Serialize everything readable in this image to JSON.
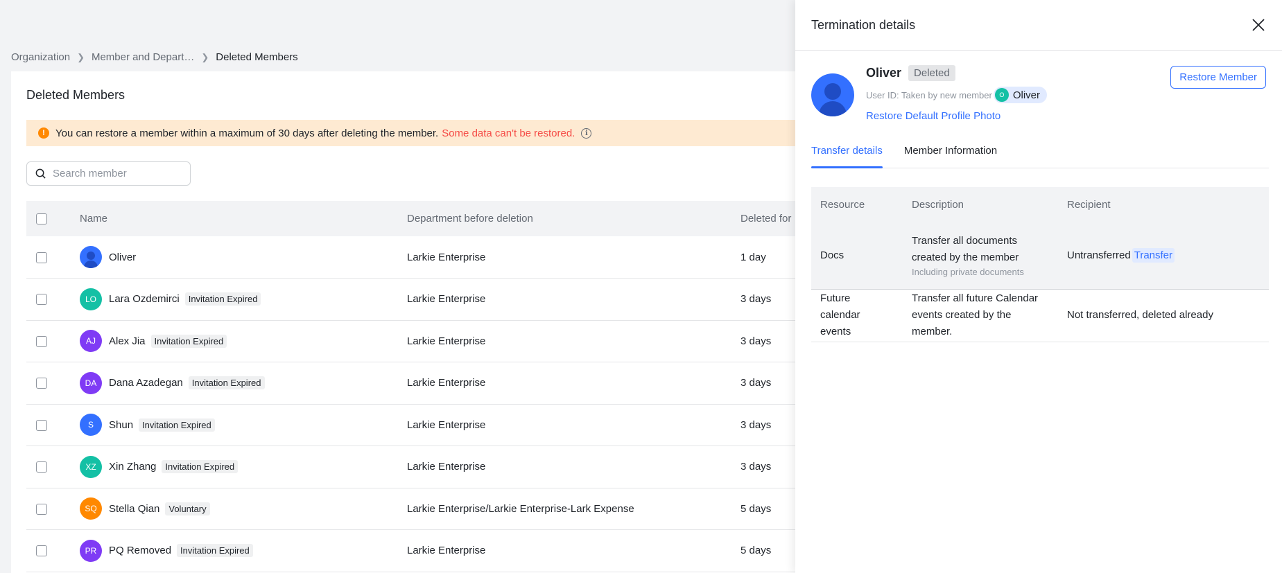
{
  "breadcrumb": {
    "items": [
      "Organization",
      "Member and Depart…",
      "Deleted Members"
    ]
  },
  "page": {
    "title": "Deleted Members",
    "notice": "You can restore a member within a maximum of 30 days after deleting the member.",
    "notice_warning": "Some data can't be restored.",
    "search_placeholder": "Search member"
  },
  "table": {
    "headers": {
      "name": "Name",
      "dept": "Department before deletion",
      "deleted": "Deleted for"
    },
    "rows": [
      {
        "initials": "",
        "name": "Oliver",
        "tag": "",
        "dept": "Larkie Enterprise",
        "deleted": "1 day",
        "color": "#3370ff"
      },
      {
        "initials": "LO",
        "name": "Lara Ozdemirci",
        "tag": "Invitation Expired",
        "dept": "Larkie Enterprise",
        "deleted": "3 days",
        "color": "#14c0a5"
      },
      {
        "initials": "AJ",
        "name": "Alex Jia",
        "tag": "Invitation Expired",
        "dept": "Larkie Enterprise",
        "deleted": "3 days",
        "color": "#7f3bf5"
      },
      {
        "initials": "DA",
        "name": "Dana Azadegan",
        "tag": "Invitation Expired",
        "dept": "Larkie Enterprise",
        "deleted": "3 days",
        "color": "#7f3bf5"
      },
      {
        "initials": "S",
        "name": "Shun",
        "tag": "Invitation Expired",
        "dept": "Larkie Enterprise",
        "deleted": "3 days",
        "color": "#3370ff"
      },
      {
        "initials": "XZ",
        "name": "Xin Zhang",
        "tag": "Invitation Expired",
        "dept": "Larkie Enterprise",
        "deleted": "3 days",
        "color": "#14c0a5"
      },
      {
        "initials": "SQ",
        "name": "Stella Qian",
        "tag": "Voluntary",
        "dept": "Larkie Enterprise/Larkie Enterprise-Lark Expense",
        "deleted": "5 days",
        "color": "#ff8800"
      },
      {
        "initials": "PR",
        "name": "PQ Removed",
        "tag": "Invitation Expired",
        "dept": "Larkie Enterprise",
        "deleted": "5 days",
        "color": "#7f3bf5"
      }
    ]
  },
  "drawer": {
    "title": "Termination details",
    "member_name": "Oliver",
    "status": "Deleted",
    "user_id_text": "User ID: Taken by new member",
    "new_member_initial": "O",
    "new_member_name": "Oliver",
    "restore_photo": "Restore Default Profile Photo",
    "restore_button": "Restore Member",
    "tabs": [
      "Transfer details",
      "Member Information"
    ],
    "resource_table": {
      "headers": {
        "resource": "Resource",
        "description": "Description",
        "recipient": "Recipient"
      },
      "rows": [
        {
          "resource": "Docs",
          "description": "Transfer all documents created by the member",
          "sub": "Including private documents",
          "recipient": "Untransferred",
          "action": "Transfer"
        },
        {
          "resource": "Future calendar events",
          "description": "Transfer all future Calendar events created by the member.",
          "recipient": "Not transferred, deleted already"
        }
      ]
    }
  }
}
